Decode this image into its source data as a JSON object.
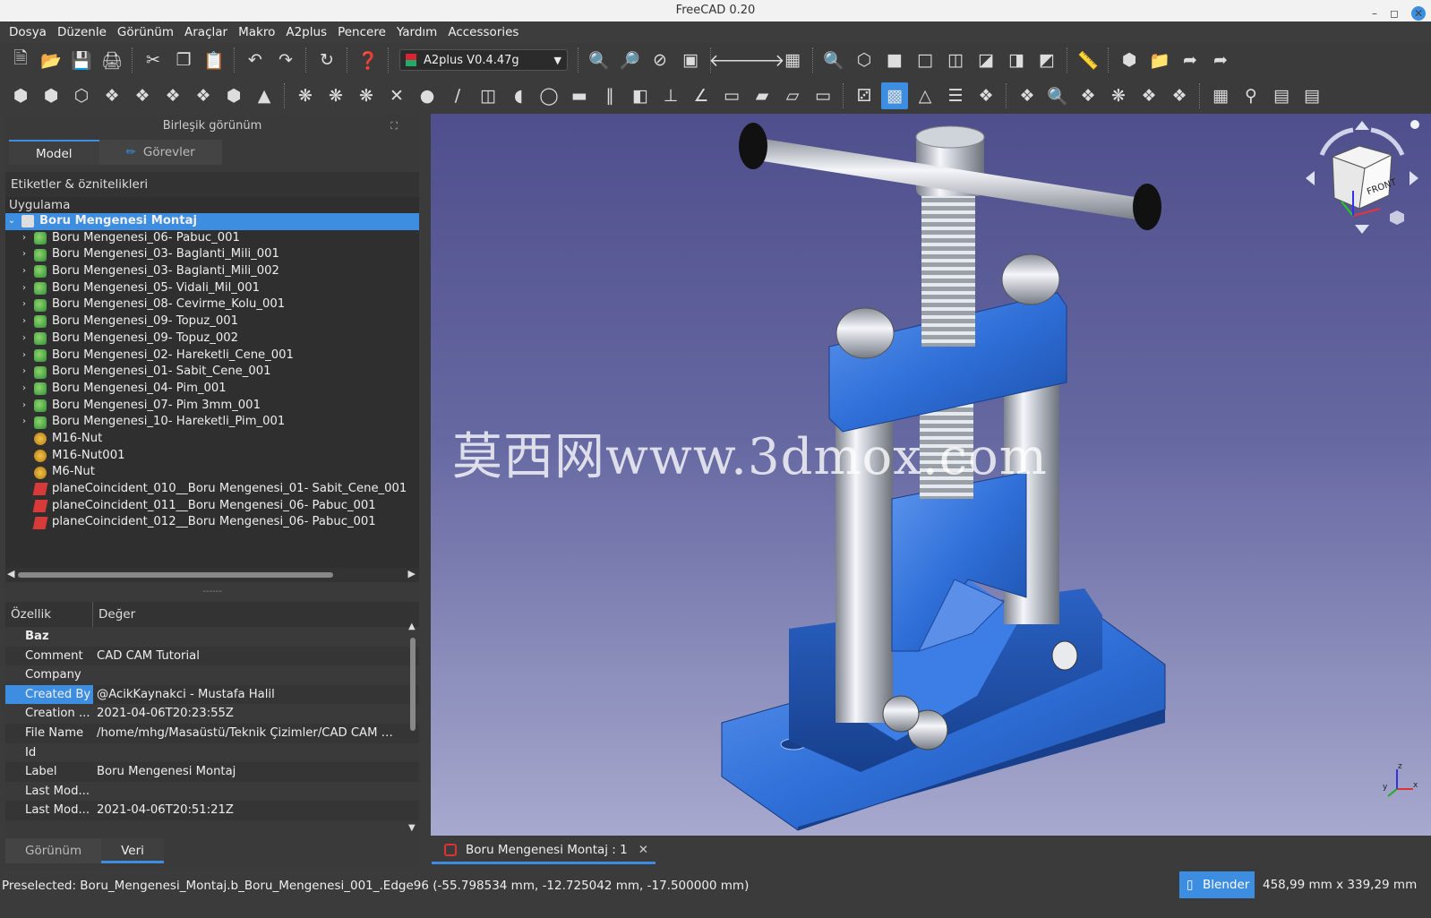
{
  "window": {
    "title": "FreeCAD 0.20"
  },
  "menu": [
    "Dosya",
    "Düzenle",
    "Görünüm",
    "Araçlar",
    "Makro",
    "A2plus",
    "Pencere",
    "Yardım",
    "Accessories"
  ],
  "toolbar": {
    "workbench": "A2plus V0.4.47g"
  },
  "combo": {
    "title": "Birleşik görünüm",
    "tabs": [
      "Model",
      "Görevler"
    ],
    "header": "Etiketler & öznitelikleri",
    "section": "Uygulama"
  },
  "tree": {
    "root": "Boru Mengenesi Montaj",
    "items": [
      {
        "label": "Boru Mengenesi_06- Pabuc_001",
        "kind": "part"
      },
      {
        "label": "Boru Mengenesi_03- Baglanti_Mili_001",
        "kind": "part"
      },
      {
        "label": "Boru Mengenesi_03- Baglanti_Mili_002",
        "kind": "part"
      },
      {
        "label": "Boru Mengenesi_05- Vidali_Mil_001",
        "kind": "part"
      },
      {
        "label": "Boru Mengenesi_08- Cevirme_Kolu_001",
        "kind": "part"
      },
      {
        "label": "Boru Mengenesi_09- Topuz_001",
        "kind": "part"
      },
      {
        "label": "Boru Mengenesi_09- Topuz_002",
        "kind": "part"
      },
      {
        "label": "Boru Mengenesi_02- Hareketli_Cene_001",
        "kind": "part"
      },
      {
        "label": "Boru Mengenesi_01- Sabit_Cene_001",
        "kind": "part"
      },
      {
        "label": "Boru Mengenesi_04- Pim_001",
        "kind": "part"
      },
      {
        "label": "Boru Mengenesi_07- Pim 3mm_001",
        "kind": "part"
      },
      {
        "label": "Boru Mengenesi_10- Hareketli_Pim_001",
        "kind": "part"
      },
      {
        "label": "M16-Nut",
        "kind": "nut"
      },
      {
        "label": "M16-Nut001",
        "kind": "nut"
      },
      {
        "label": "M6-Nut",
        "kind": "nut"
      },
      {
        "label": "planeCoincident_010__Boru Mengenesi_01- Sabit_Cene_001",
        "kind": "cons"
      },
      {
        "label": "planeCoincident_011__Boru Mengenesi_06- Pabuc_001",
        "kind": "cons"
      },
      {
        "label": "planeCoincident_012__Boru Mengenesi_06- Pabuc_001",
        "kind": "cons"
      }
    ]
  },
  "props": {
    "headers": [
      "Özellik",
      "Değer"
    ],
    "group": "Baz",
    "rows": [
      {
        "k": "Comment",
        "v": "CAD CAM Tutorial"
      },
      {
        "k": "Company",
        "v": ""
      },
      {
        "k": "Created By",
        "v": "@AcikKaynakci - Mustafa Halil",
        "sel": true
      },
      {
        "k": "Creation ...",
        "v": "2021-04-06T20:23:55Z"
      },
      {
        "k": "File Name",
        "v": "/home/mhg/Masaüstü/Teknik Çizimler/CAD CAM T..."
      },
      {
        "k": "Id",
        "v": ""
      },
      {
        "k": "Label",
        "v": "Boru Mengenesi Montaj"
      },
      {
        "k": "Last Mod...",
        "v": ""
      },
      {
        "k": "Last Mod...",
        "v": "2021-04-06T20:51:21Z"
      }
    ]
  },
  "bottom_tabs": [
    "Görünüm",
    "Veri"
  ],
  "viewer": {
    "watermark": "莫西网www.3dmox.com",
    "cube_face": "FRONT"
  },
  "doc_tab": {
    "label": "Boru Mengenesi Montaj : 1"
  },
  "status": {
    "text": "Preselected: Boru_Mengenesi_Montaj.b_Boru_Mengenesi_001_.Edge96 (-55.798534 mm, -12.725042 mm, -17.500000 mm)",
    "nav": "Blender",
    "dims": "458,99 mm x 339,29 mm"
  },
  "colors": {
    "accent": "#3d8ee0",
    "part": "#2f6fd8"
  }
}
